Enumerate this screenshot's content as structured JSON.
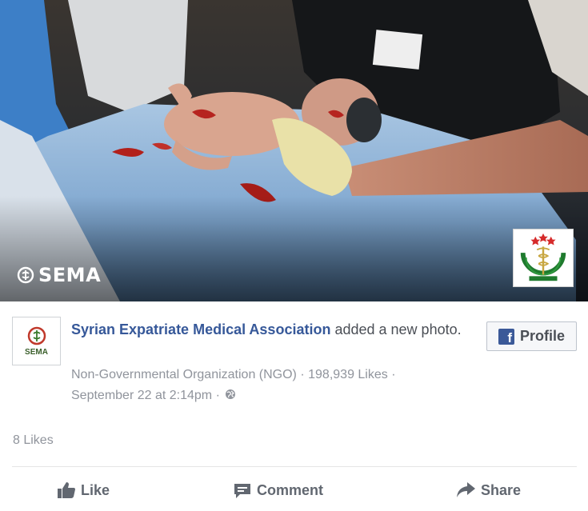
{
  "photo": {
    "watermark_text": "SEMA",
    "badge_text": "SEMA",
    "emblem_icon": "medical-caduceus-emblem"
  },
  "post": {
    "avatar_text": "SEMA",
    "author": "Syrian Expatriate Medical Association",
    "action_text": "added a new photo.",
    "category": "Non-Governmental Organization (NGO)",
    "page_likes": "198,939 Likes",
    "separator": "·",
    "timestamp": "September 22 at 2:14pm",
    "privacy_icon": "globe-icon"
  },
  "profile_button": {
    "label": "Profile",
    "icon": "facebook-icon"
  },
  "reactions": {
    "likes_count": "8 Likes"
  },
  "actions": {
    "like": "Like",
    "comment": "Comment",
    "share": "Share"
  },
  "colors": {
    "link_blue": "#365899",
    "meta_gray": "#90949c",
    "action_gray": "#616770",
    "facebook_blue": "#3b5998",
    "emblem_green": "#1f7a2e",
    "emblem_red": "#d62b2b"
  }
}
